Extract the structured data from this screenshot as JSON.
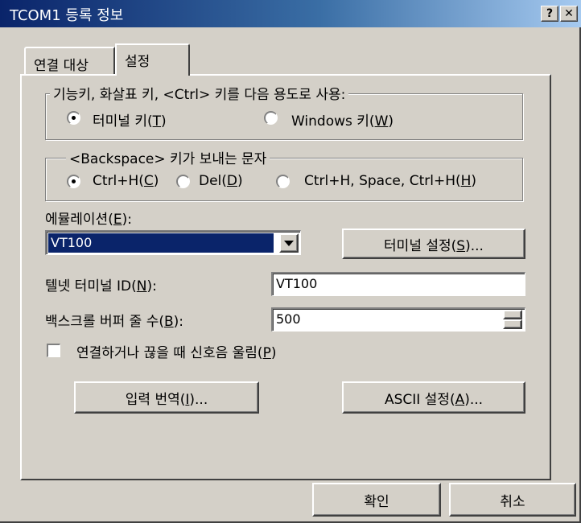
{
  "window": {
    "title": "TCOM1 등록 정보",
    "help_label": "?",
    "close_label": "✕"
  },
  "tabs": [
    {
      "label": "연결 대상",
      "selected": false
    },
    {
      "label": "설정",
      "selected": true
    }
  ],
  "function_keys_group": {
    "legend": "기능키, 화살표 키, <Ctrl> 키를 다음 용도로 사용:",
    "options": [
      {
        "prefix": "터미널 키(",
        "mnemonic": "T",
        "suffix": ")",
        "checked": true
      },
      {
        "prefix": "Windows 키(",
        "mnemonic": "W",
        "suffix": ")",
        "checked": false
      }
    ]
  },
  "backspace_group": {
    "legend": "<Backspace> 키가 보내는 문자",
    "options": [
      {
        "prefix": "Ctrl+H(",
        "mnemonic": "C",
        "suffix": ")",
        "checked": true
      },
      {
        "prefix": "Del(",
        "mnemonic": "D",
        "suffix": ")",
        "checked": false
      },
      {
        "prefix": "Ctrl+H, Space, Ctrl+H(",
        "mnemonic": "H",
        "suffix": ")",
        "checked": false
      }
    ]
  },
  "emulation": {
    "label_prefix": "에뮬레이션(",
    "label_mnemonic": "E",
    "label_suffix": "):",
    "selected": "VT100"
  },
  "terminal_settings_button": {
    "prefix": "터미널 설정(",
    "mnemonic": "S",
    "suffix": ")..."
  },
  "telnet_id": {
    "label_prefix": "텔넷 터미널 ID(",
    "label_mnemonic": "N",
    "label_suffix": "):",
    "value": "VT100"
  },
  "scrollback": {
    "label_prefix": "백스크롤 버퍼 줄 수(",
    "label_mnemonic": "B",
    "label_suffix": "):",
    "value": "500"
  },
  "beep_checkbox": {
    "prefix": "연결하거나 끊을 때 신호음 울림(",
    "mnemonic": "P",
    "suffix": ")",
    "checked": false
  },
  "input_translation_button": {
    "prefix": "입력 번역(",
    "mnemonic": "I",
    "suffix": ")..."
  },
  "ascii_settings_button": {
    "prefix": "ASCII 설정(",
    "mnemonic": "A",
    "suffix": ")..."
  },
  "footer": {
    "ok_label": "확인",
    "cancel_label": "취소"
  },
  "colors": {
    "titlebar_start": "#0a246a",
    "titlebar_end": "#a6caf0",
    "face": "#d4d0c8",
    "selection": "#0a246a"
  }
}
